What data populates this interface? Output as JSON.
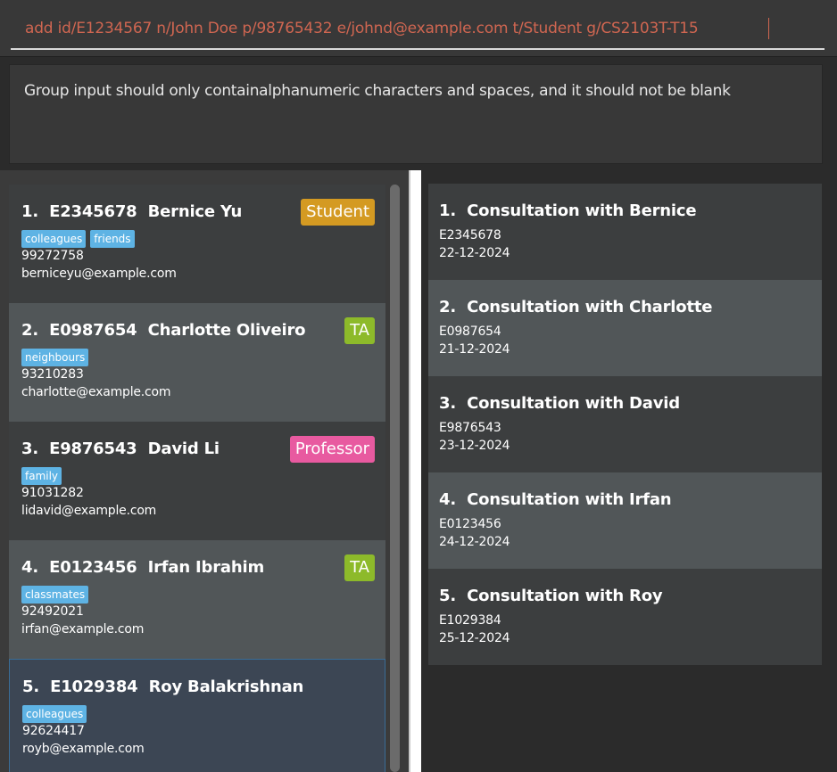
{
  "command_box": {
    "value": "add id/E1234567 n/John Doe p/98765432 e/johnd@example.com t/Student g/CS2103T-T15"
  },
  "result_display": {
    "message": "Group input should only containalphanumeric characters and spaces, and it should not be blank"
  },
  "colors": {
    "student_badge": "#d49a22",
    "ta_badge": "#8dba2a",
    "professor_badge": "#e85aa0",
    "tag": "#5eb3e4",
    "command_text": "#d06651"
  },
  "persons": [
    {
      "index": "1.",
      "id": "E2345678",
      "name": "Bernice Yu",
      "role": "Student",
      "tags": [
        "colleagues",
        "friends"
      ],
      "phone": "99272758",
      "email": "berniceyu@example.com"
    },
    {
      "index": "2.",
      "id": "E0987654",
      "name": "Charlotte Oliveiro",
      "role": "TA",
      "tags": [
        "neighbours"
      ],
      "phone": "93210283",
      "email": "charlotte@example.com"
    },
    {
      "index": "3.",
      "id": "E9876543",
      "name": "David Li",
      "role": "Professor",
      "tags": [
        "family"
      ],
      "phone": "91031282",
      "email": "lidavid@example.com"
    },
    {
      "index": "4.",
      "id": "E0123456",
      "name": "Irfan Ibrahim",
      "role": "TA",
      "tags": [
        "classmates"
      ],
      "phone": "92492021",
      "email": "irfan@example.com"
    },
    {
      "index": "5.",
      "id": "E1029384",
      "name": "Roy Balakrishnan",
      "role": "",
      "tags": [
        "colleagues"
      ],
      "phone": "92624417",
      "email": "royb@example.com"
    }
  ],
  "appointments": [
    {
      "index": "1.",
      "title": "Consultation with Bernice",
      "student_id": "E2345678",
      "date": "22-12-2024"
    },
    {
      "index": "2.",
      "title": "Consultation with Charlotte",
      "student_id": "E0987654",
      "date": "21-12-2024"
    },
    {
      "index": "3.",
      "title": "Consultation with David",
      "student_id": "E9876543",
      "date": "23-12-2024"
    },
    {
      "index": "4.",
      "title": "Consultation with Irfan",
      "student_id": "E0123456",
      "date": "24-12-2024"
    },
    {
      "index": "5.",
      "title": "Consultation with Roy",
      "student_id": "E1029384",
      "date": "25-12-2024"
    }
  ]
}
